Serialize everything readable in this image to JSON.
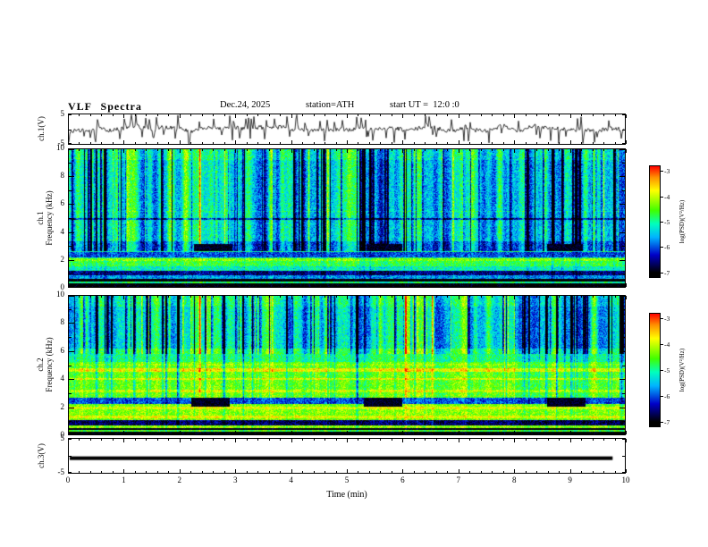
{
  "title": {
    "main": "VLF Spectra",
    "date": "Dec.24, 2025",
    "station": "station=ATH",
    "start_ut": "start UT =  12:0 :0"
  },
  "chart_data": {
    "type": "multi-panel",
    "xlabel": "Time (min)",
    "x_range": [
      0,
      10
    ],
    "xticks": [
      0,
      1,
      2,
      3,
      4,
      5,
      6,
      7,
      8,
      9,
      10
    ],
    "x_minor_step": 0.2,
    "colorbar": {
      "label": "log(PSD)(V²/Hz)",
      "ticks": [
        -3,
        -4,
        -5,
        -6,
        -7
      ],
      "gradient": [
        {
          "color": "#ff0000",
          "pos": 0
        },
        {
          "color": "#ff9000",
          "pos": 10
        },
        {
          "color": "#ffff00",
          "pos": 22
        },
        {
          "color": "#40ff00",
          "pos": 40
        },
        {
          "color": "#00ffbe",
          "pos": 52
        },
        {
          "color": "#00b4ff",
          "pos": 64
        },
        {
          "color": "#0000c8",
          "pos": 80
        },
        {
          "color": "#000000",
          "pos": 96
        }
      ]
    },
    "panels": [
      {
        "id": "ch1-waveform",
        "type": "line",
        "ylabel": "ch.1(V)",
        "y_range": [
          -5,
          5
        ],
        "yticks": [
          5,
          -5
        ],
        "seed": 7,
        "noise_amp": 1.4,
        "spike_count": 85,
        "spike_min": 2.2,
        "spike_max": 4.3,
        "events": [
          2.35,
          6.05
        ]
      },
      {
        "id": "ch1-spectrogram",
        "type": "heatmap",
        "ylabel_lines": [
          "ch.1",
          "Frequency (kHz)"
        ],
        "y_range": [
          0,
          10
        ],
        "yticks": [
          0,
          2,
          4,
          6,
          8,
          10
        ],
        "z_range": [
          -7,
          -3
        ],
        "seed": 13,
        "noise": 0.9,
        "streak_scale": 1.0,
        "streak_fmin": 2.6,
        "events": [
          2.35,
          6.05
        ],
        "bands": [
          {
            "f0": 0.0,
            "f1": 0.55,
            "v": -7.0
          },
          {
            "f0": 0.55,
            "f1": 0.8,
            "v": -5.6
          },
          {
            "f0": 0.8,
            "f1": 1.15,
            "v": -6.4
          },
          {
            "f0": 1.15,
            "f1": 1.5,
            "v": -5.1
          },
          {
            "f0": 1.5,
            "f1": 1.85,
            "v": -4.7
          },
          {
            "f0": 1.85,
            "f1": 2.15,
            "v": -5.0
          },
          {
            "f0": 2.15,
            "f1": 2.6,
            "v": -5.9
          },
          {
            "f0": 2.6,
            "f1": 3.3,
            "v": -5.7
          },
          {
            "f0": 3.3,
            "f1": 10.01,
            "v": -5.25
          }
        ],
        "lines": [
          {
            "f": 0.3,
            "v": -4.9,
            "w": 0.07
          },
          {
            "f": 1.95,
            "v": -4.35,
            "w": 0.1
          },
          {
            "f": 2.55,
            "v": -5.0,
            "w": 0.05
          },
          {
            "f": 4.95,
            "v": -6.1,
            "w": 0.05,
            "dark": true
          },
          {
            "f": 5.5,
            "v": -5.0,
            "w": 0.04
          }
        ],
        "dropouts": {
          "t": [
            [
              2.25,
              2.95
            ],
            [
              5.35,
              6.0
            ],
            [
              8.6,
              9.25
            ]
          ],
          "f": [
            2.55,
            3.1
          ]
        }
      },
      {
        "id": "ch2-spectrogram",
        "type": "heatmap",
        "ylabel_lines": [
          "ch.2",
          "Frequency (kHz)"
        ],
        "y_range": [
          0,
          10
        ],
        "yticks": [
          0,
          2,
          4,
          6,
          8,
          10
        ],
        "z_range": [
          -7,
          -3
        ],
        "seed": 29,
        "noise": 0.85,
        "streak_scale": 1.1,
        "streak_fmin": 5.8,
        "events": [
          2.35,
          6.05
        ],
        "bands": [
          {
            "f0": 0.0,
            "f1": 0.4,
            "v": -7.0
          },
          {
            "f0": 0.4,
            "f1": 0.62,
            "v": -4.3
          },
          {
            "f0": 0.62,
            "f1": 1.0,
            "v": -6.5
          },
          {
            "f0": 1.0,
            "f1": 2.2,
            "v": -4.35
          },
          {
            "f0": 2.2,
            "f1": 2.6,
            "v": -5.9
          },
          {
            "f0": 2.6,
            "f1": 5.2,
            "v": -4.5
          },
          {
            "f0": 5.2,
            "f1": 6.2,
            "v": -4.9
          },
          {
            "f0": 6.2,
            "f1": 10.01,
            "v": -5.3
          }
        ],
        "lines": [
          {
            "f": 0.25,
            "v": -4.6,
            "w": 0.06
          },
          {
            "f": 1.25,
            "v": -3.9,
            "w": 0.09
          },
          {
            "f": 1.9,
            "v": -3.95,
            "w": 0.09
          },
          {
            "f": 3.1,
            "v": -4.05,
            "w": 0.09
          },
          {
            "f": 4.0,
            "v": -3.95,
            "w": 0.09
          },
          {
            "f": 4.65,
            "v": -3.85,
            "w": 0.11
          },
          {
            "f": 5.05,
            "v": -4.3,
            "w": 0.07
          }
        ],
        "dropouts": {
          "t": [
            [
              2.2,
              2.9
            ],
            [
              5.3,
              6.0
            ],
            [
              8.6,
              9.3
            ]
          ],
          "f": [
            1.95,
            2.6
          ]
        }
      },
      {
        "id": "ch3-waveform",
        "type": "line",
        "ylabel": "ch.3(V)",
        "y_range": [
          -5,
          5
        ],
        "yticks": [
          5,
          -5
        ],
        "flat_value": -0.7,
        "x_end": 9.78
      }
    ]
  }
}
